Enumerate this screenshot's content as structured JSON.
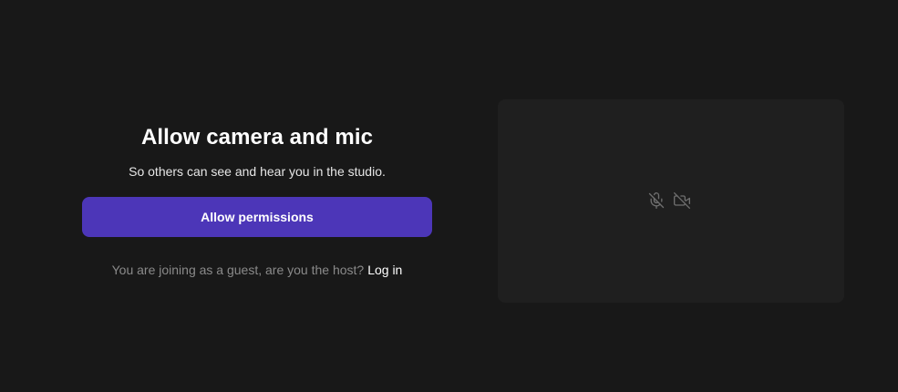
{
  "permissions": {
    "title": "Allow camera and mic",
    "subtitle": "So others can see and hear you in the studio.",
    "allow_button_label": "Allow permissions",
    "guest_prompt": "You are joining as a guest, are you the host?",
    "login_link_label": "Log in"
  },
  "preview": {
    "icons": [
      "mic-off-icon",
      "camera-off-icon"
    ]
  },
  "colors": {
    "background": "#181818",
    "preview_background": "#1f1f1f",
    "accent": "#4c36b8",
    "muted_text": "#8a8a8a"
  }
}
